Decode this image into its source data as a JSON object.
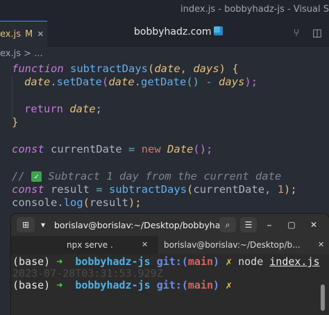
{
  "window": {
    "title": "index.js - bobbyhadz-js - Visual S"
  },
  "tab": {
    "name": "ex.js",
    "modified": "M",
    "close": "✕"
  },
  "center_label": "bobbyhadz.com",
  "breadcrumb": {
    "file": "ex.js",
    "sep": ">",
    "rest": "..."
  },
  "code": {
    "l1": {
      "kw": "function",
      "fn": "subtractDays",
      "p1": "date",
      "comma": ", ",
      "p2": "days",
      "close": ") {"
    },
    "l2": {
      "obj": "date",
      "m1": "setDate",
      "obj2": "date",
      "m2": "getDate",
      "minus": "-",
      "p": "days",
      "end": ");"
    },
    "l4": {
      "kw": "return",
      "v": "date",
      "end": ";"
    },
    "l5": {
      "brace": "}"
    },
    "l7": {
      "kw": "const",
      "var": "currentDate",
      "eq": "=",
      "new": "new",
      "cls": "Date",
      "end": "();"
    },
    "l9": {
      "comment_start": "//",
      "comment": "Subtract 1 day from the current date"
    },
    "l10": {
      "kw": "const",
      "var": "result",
      "eq": "=",
      "fn": "subtractDays",
      "arg": "currentDate",
      "comma": ", ",
      "num": "1",
      "end": ");"
    },
    "l11": {
      "obj": "console",
      "m": "log",
      "arg": "result",
      "end": ");"
    }
  },
  "terminal": {
    "title": "borislav@borislav:~/Desktop/bobbyhadz-r...",
    "tabs": [
      {
        "label": "npx serve .",
        "close": "✕"
      },
      {
        "label": "borislav@borislav:~/Desktop/b...",
        "close": "✕"
      }
    ],
    "prompt1": {
      "env": "(base)",
      "arrow": "➜",
      "repo": "bobbyhadz-js",
      "git": "git:(",
      "branch": "main",
      "git_close": ")",
      "x": "✗",
      "cmd": "node",
      "file": "index.js"
    },
    "output": "2023-07-28T03:31:53.929Z",
    "prompt2": {
      "env": "(base)",
      "arrow": "➜",
      "repo": "bobbyhadz-js",
      "git": "git:(",
      "branch": "main",
      "git_close": ")",
      "x": "✗"
    }
  }
}
